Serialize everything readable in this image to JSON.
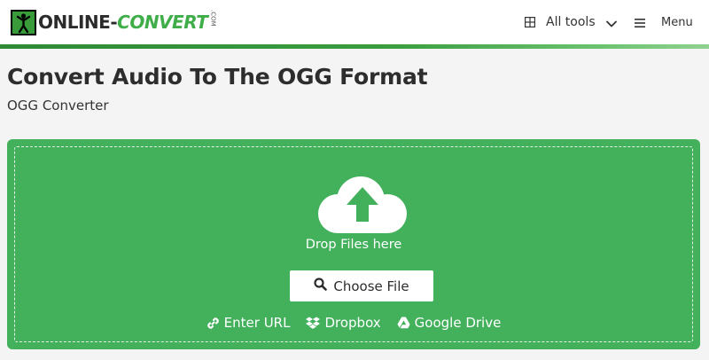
{
  "header": {
    "logo": {
      "part1": "ONLINE-",
      "part2": "CONVERT",
      "part3": ".COM"
    },
    "all_tools_label": "All tools",
    "menu_label": "Menu"
  },
  "page": {
    "title": "Convert Audio To The OGG Format",
    "subtitle": "OGG Converter"
  },
  "upload": {
    "drop_text": "Drop Files here",
    "choose_file_label": "Choose File",
    "sources": [
      {
        "label": "Enter URL",
        "icon": "link-icon"
      },
      {
        "label": "Dropbox",
        "icon": "dropbox-icon"
      },
      {
        "label": "Google Drive",
        "icon": "google-drive-icon"
      }
    ]
  },
  "colors": {
    "brand_green": "#43b05c",
    "logo_green": "#3fae49",
    "stripe_dark": "#2e8a35",
    "stripe_light": "#8fd18f"
  }
}
